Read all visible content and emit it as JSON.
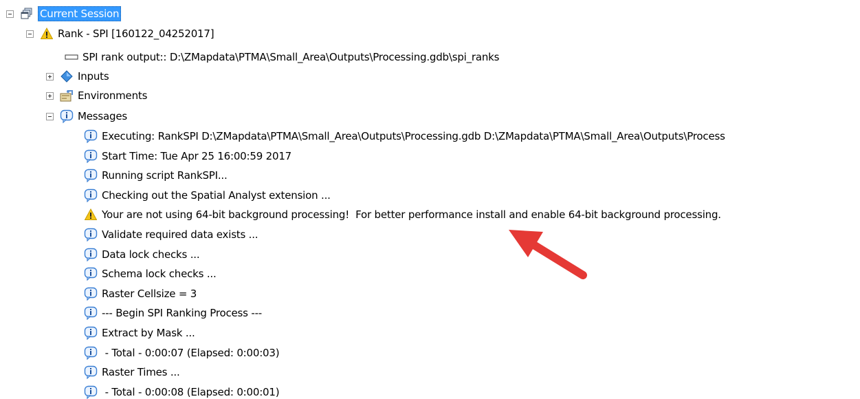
{
  "tree": {
    "root": {
      "label": "Current Session",
      "icon": "session-stack-icon",
      "expanded": true
    },
    "tool": {
      "label": "Rank - SPI [160122_04252017]",
      "icon": "warning-icon",
      "expanded": true
    },
    "output": {
      "label": "SPI rank output:: D:\\ZMapdata\\PTMA\\Small_Area\\Outputs\\Processing.gdb\\spi_ranks",
      "icon": "output-param-icon"
    },
    "inputs": {
      "label": "Inputs",
      "icon": "inputs-diamond-icon",
      "expanded": false
    },
    "environments": {
      "label": "Environments",
      "icon": "environments-icon",
      "expanded": false
    },
    "messages_node": {
      "label": "Messages",
      "icon": "info-icon",
      "expanded": true
    },
    "messages": [
      {
        "type": "info",
        "text": "Executing: RankSPI D:\\ZMapdata\\PTMA\\Small_Area\\Outputs\\Processing.gdb D:\\ZMapdata\\PTMA\\Small_Area\\Outputs\\Process"
      },
      {
        "type": "info",
        "text": "Start Time: Tue Apr 25 16:00:59 2017"
      },
      {
        "type": "info",
        "text": "Running script RankSPI..."
      },
      {
        "type": "info",
        "text": "Checking out the Spatial Analyst extension ..."
      },
      {
        "type": "warning",
        "text": "Your are not using 64-bit background processing!  For better performance install and enable 64-bit background processing."
      },
      {
        "type": "info",
        "text": "Validate required data exists ..."
      },
      {
        "type": "info",
        "text": "Data lock checks ..."
      },
      {
        "type": "info",
        "text": "Schema lock checks ..."
      },
      {
        "type": "info",
        "text": "Raster Cellsize = 3"
      },
      {
        "type": "info",
        "text": "--- Begin SPI Ranking Process ---"
      },
      {
        "type": "info",
        "text": "Extract by Mask ..."
      },
      {
        "type": "info",
        "text": " - Total - 0:00:07 (Elapsed: 0:00:03)"
      },
      {
        "type": "info",
        "text": "Raster Times ..."
      },
      {
        "type": "info",
        "text": " - Total - 0:00:08 (Elapsed: 0:00:01)"
      }
    ]
  },
  "annotation": {
    "icon": "red-arrow-icon",
    "color": "#e53935"
  },
  "colors": {
    "selection": "#3399ff",
    "info": "#3a7fd4",
    "warning": "#f5c518"
  }
}
